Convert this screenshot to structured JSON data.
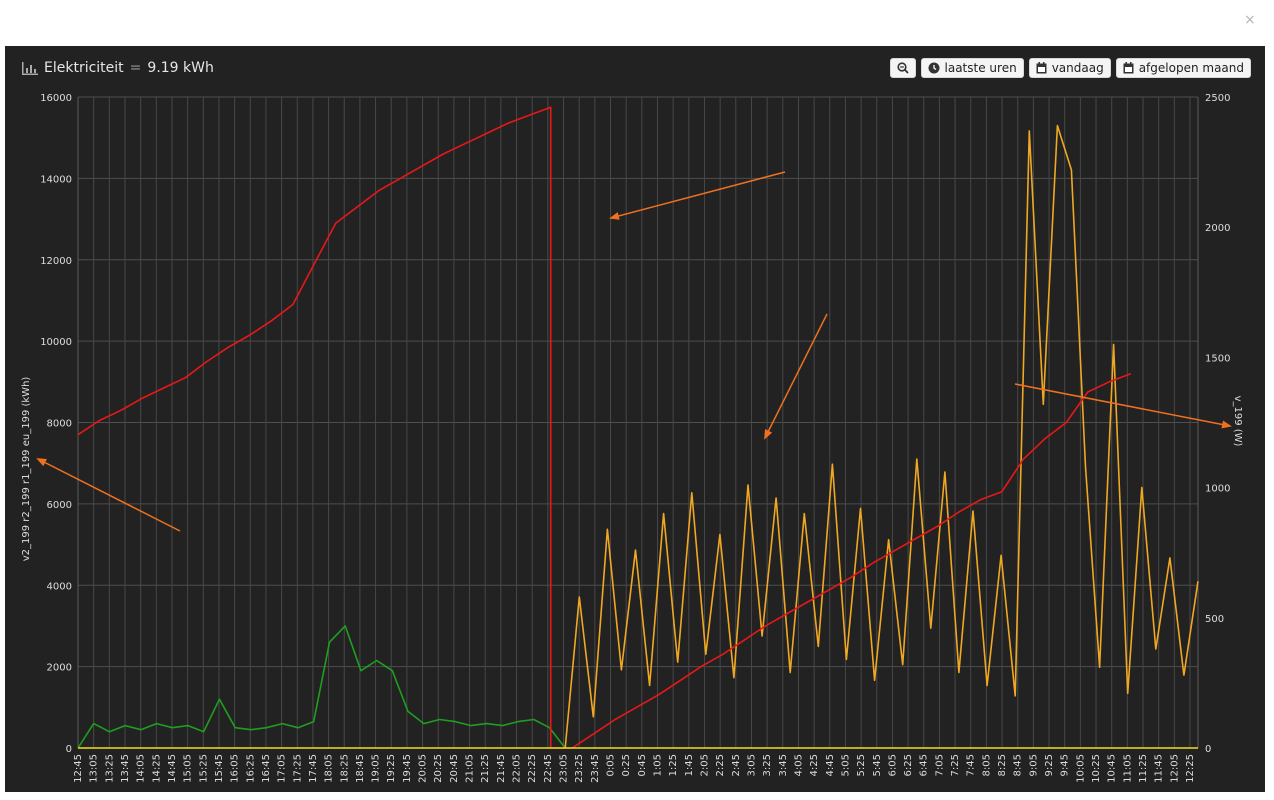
{
  "window": {
    "close_glyph": "×"
  },
  "header": {
    "title": "Elektriciteit",
    "equals": "=",
    "total": "9.19 kWh",
    "icon": "bar-chart-icon"
  },
  "toolbar": {
    "zoom_icon": "zoom-out-icon",
    "buttons": [
      {
        "label": "laatste uren",
        "icon": "clock-icon"
      },
      {
        "label": "vandaag",
        "icon": "calendar-icon"
      },
      {
        "label": "afgelopen maand",
        "icon": "calendar-icon"
      }
    ]
  },
  "chart_data": {
    "type": "line",
    "ylabel_left": "v2_199 r2_199 r1_199 eu_199 (kWh)",
    "ylabel_right": "v_199 (W)",
    "ylim_left": [
      0,
      16000
    ],
    "ylim_right": [
      0,
      2500
    ],
    "yticks_left": [
      "0",
      "2000",
      "4000",
      "6000",
      "8000",
      "10000",
      "12000",
      "14000",
      "16000"
    ],
    "yticks_right": [
      "0",
      "500",
      "1000",
      "1500",
      "2000",
      "2500"
    ],
    "categories": [
      "12:45",
      "13:05",
      "13:25",
      "13:45",
      "14:05",
      "14:25",
      "14:45",
      "15:05",
      "15:25",
      "15:45",
      "16:05",
      "16:25",
      "16:45",
      "17:05",
      "17:25",
      "17:45",
      "18:05",
      "18:25",
      "18:45",
      "19:05",
      "19:25",
      "19:45",
      "20:05",
      "20:25",
      "20:45",
      "21:05",
      "21:25",
      "21:45",
      "22:05",
      "22:25",
      "22:45",
      "23:05",
      "23:25",
      "23:45",
      "0:05",
      "0:25",
      "0:45",
      "1:05",
      "1:25",
      "1:45",
      "2:05",
      "2:25",
      "2:45",
      "3:05",
      "3:25",
      "3:45",
      "4:05",
      "4:25",
      "4:45",
      "5:05",
      "5:25",
      "5:45",
      "6:05",
      "6:25",
      "6:45",
      "7:05",
      "7:25",
      "7:45",
      "8:05",
      "8:25",
      "8:45",
      "9:05",
      "9:25",
      "9:45",
      "10:05",
      "10:25",
      "10:45",
      "11:05",
      "11:25",
      "11:45",
      "12:05",
      "12:25"
    ],
    "grid": true,
    "series": [
      {
        "color": "#e81818",
        "axis": "left",
        "values": [
          7700,
          8050,
          8300,
          8600,
          8850,
          9100,
          9500,
          9850,
          10150,
          10500,
          10900,
          11900,
          12900,
          13300,
          13700,
          14000,
          14300,
          14600,
          14850,
          15100,
          15350,
          15550,
          15750,
          0,
          350,
          700,
          1000,
          1300,
          1650,
          2000,
          2300,
          2650,
          3000,
          3300,
          3600,
          3900,
          4200,
          4550,
          4850,
          5150,
          5450,
          5800,
          6100,
          6300,
          7100,
          7600,
          8000,
          8750,
          9000,
          9200
        ]
      },
      {
        "color": "#f0a823",
        "axis": "right",
        "values": [
          0,
          580,
          120,
          840,
          300,
          760,
          240,
          900,
          330,
          980,
          360,
          820,
          270,
          1010,
          430,
          960,
          290,
          900,
          390,
          1090,
          340,
          920,
          260,
          800,
          320,
          1110,
          460,
          1060,
          290,
          910,
          240,
          740,
          200,
          2370,
          1320,
          2390,
          2220,
          1080,
          310,
          1550,
          210,
          1000,
          380,
          730,
          280,
          640
        ]
      },
      {
        "color": "#1f9e1f",
        "axis": "left",
        "values": [
          0,
          600,
          400,
          550,
          450,
          600,
          500,
          550,
          400,
          1200,
          500,
          450,
          500,
          600,
          500,
          650,
          2600,
          3000,
          1900,
          2150,
          1900,
          900,
          600,
          700,
          650,
          550,
          600,
          550,
          650,
          700,
          500,
          0
        ]
      },
      {
        "color": "#f0e020",
        "axis": "left",
        "values": [
          0,
          0
        ]
      }
    ]
  }
}
